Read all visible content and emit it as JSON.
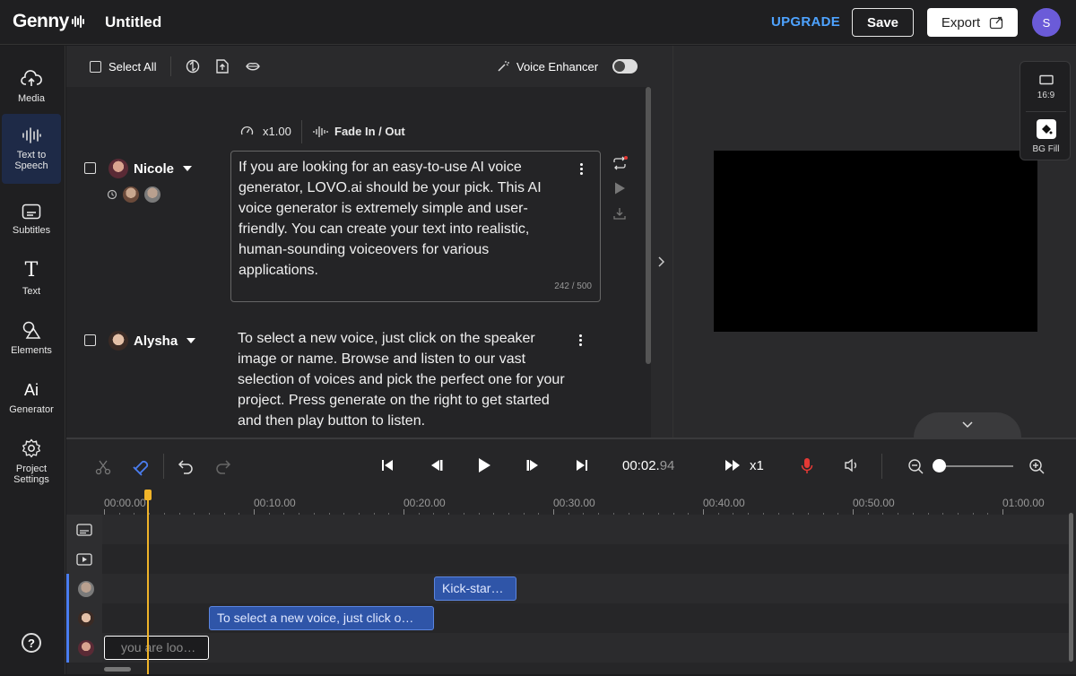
{
  "app": {
    "logo": "Genny",
    "doc_title": "Untitled",
    "upgrade_label": "UPGRADE",
    "save_label": "Save",
    "export_label": "Export",
    "user_initial": "S"
  },
  "nav": {
    "items": [
      {
        "label": "Media",
        "icon": "cloud-upload-icon"
      },
      {
        "label": "Text to Speech",
        "icon": "waveform-icon"
      },
      {
        "label": "Subtitles",
        "icon": "subtitles-icon"
      },
      {
        "label": "Text",
        "icon": "text-icon"
      },
      {
        "label": "Elements",
        "icon": "shapes-icon"
      },
      {
        "label": "Generator",
        "icon": "ai-icon"
      },
      {
        "label": "Project Settings",
        "icon": "gear-icon"
      }
    ],
    "help": "?"
  },
  "editor": {
    "select_all": "Select All",
    "voice_enhancer": "Voice Enhancer",
    "speed": "x1.00",
    "fade": "Fade In / Out",
    "blocks": [
      {
        "speaker": "Nicole",
        "text": "If you are looking for an easy-to-use AI voice generator, LOVO.ai should be your pick. This AI voice generator is extremely simple and user-friendly. You can create your text into realistic, human-sounding voiceovers for various applications.",
        "char_count": "242 / 500"
      },
      {
        "speaker": "Alysha",
        "text": "To select a new voice, just click on the speaker image or name. Browse and listen to our vast selection of voices and pick the perfect one for your project. Press generate on the right to get started and then play button to listen."
      }
    ]
  },
  "preview": {
    "ratio_label": "16:9",
    "bg_fill_label": "BG Fill"
  },
  "timeline": {
    "timecode_main": "00:02.",
    "timecode_ms": "94",
    "speed": "x1",
    "ruler": [
      "00:00.00",
      "00:10.00",
      "00:20.00",
      "00:30.00",
      "00:40.00",
      "00:50.00",
      "01:00.00"
    ],
    "clips": {
      "kick": "Kick-star…",
      "select": "To select a new voice, just click o…",
      "nicole": "you are loo…"
    }
  },
  "colors": {
    "accent": "#4ea3ff",
    "clip": "#2f55a8",
    "playhead": "#f0b429",
    "record": "#e53935",
    "avatar": "#6b5bd8"
  }
}
